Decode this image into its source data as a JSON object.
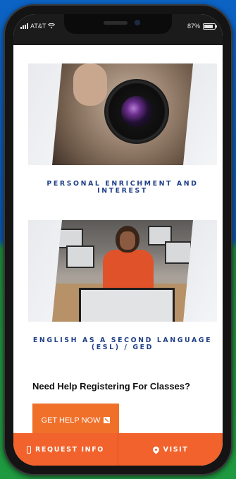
{
  "status_bar": {
    "carrier": "AT&T",
    "battery": "87%",
    "battery_level": 0.87
  },
  "tiles": [
    {
      "title": "PERSONAL ENRICHMENT AND INTEREST",
      "image": "camera-photographer-photo"
    },
    {
      "title": "ENGLISH AS A SECOND LANGUAGE (ESL) / GED",
      "image": "computer-classroom-photo"
    }
  ],
  "help": {
    "heading": "Need Help Registering For Classes?",
    "button_label": "GET HELP NOW",
    "button_icon": "external-link-icon"
  },
  "bottom_bar": {
    "request_info": {
      "label": "REQUEST INFO",
      "icon": "mobile-phone-icon"
    },
    "visit": {
      "label": "VISIT",
      "icon": "map-pin-icon"
    }
  },
  "colors": {
    "accent_orange": "#f0702a",
    "title_blue": "#1f3f86",
    "bottom_bar": "#f1622c"
  }
}
